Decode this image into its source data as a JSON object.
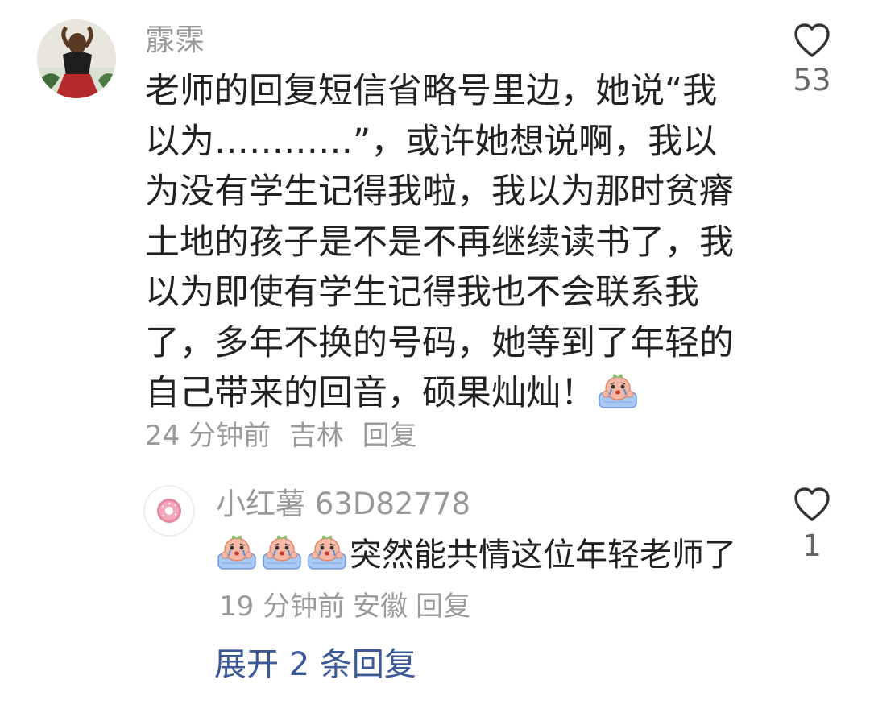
{
  "comment": {
    "author": "霡霂",
    "text": "老师的回复短信省略号里边，她说“我以为…………”，或许她想说啊，我以为没有学生记得我啦，我以为那时贫瘠土地的孩子是不是不再继续读书了，我以为即使有学生记得我也不会联系我了，多年不换的号码，她等到了年轻的自己带来的回音，硕果灿灿！",
    "emoji": "crying-emoji",
    "time": "24 分钟前",
    "location": "吉林",
    "reply_label": "回复",
    "likes": "53",
    "like_icon": "heart-outline-icon"
  },
  "reply": {
    "author": "小红薯 63D82778",
    "emojis": [
      "crying-emoji",
      "crying-emoji",
      "crying-emoji"
    ],
    "text": "突然能共情这位年轻老师了",
    "time": "19 分钟前",
    "location": "安徽",
    "reply_label": "回复",
    "likes": "1",
    "like_icon": "heart-outline-icon"
  },
  "expand_label": "展开 2 条回复",
  "colors": {
    "link": "#3b5998",
    "meta": "#9a9a9a",
    "text": "#222222"
  }
}
